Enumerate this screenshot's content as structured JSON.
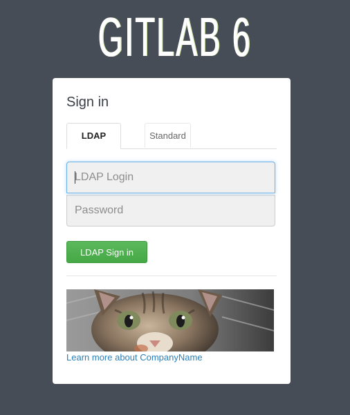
{
  "brand": {
    "logo_text": "GITLAB 6"
  },
  "signin": {
    "title": "Sign in",
    "tabs": [
      {
        "label": "LDAP",
        "active": true
      },
      {
        "label": "Standard",
        "active": false
      }
    ],
    "login_field": {
      "placeholder": "LDAP Login",
      "value": ""
    },
    "password_field": {
      "placeholder": "Password",
      "value": ""
    },
    "submit_label": "LDAP Sign in",
    "banner_image": "kitten-photo",
    "learn_more_link": "Learn more about CompanyName"
  },
  "colors": {
    "background": "#474d57",
    "card": "#ffffff",
    "primary_button": "#5cb85c",
    "link": "#2a7fb8",
    "focus_border": "#66afe9"
  }
}
